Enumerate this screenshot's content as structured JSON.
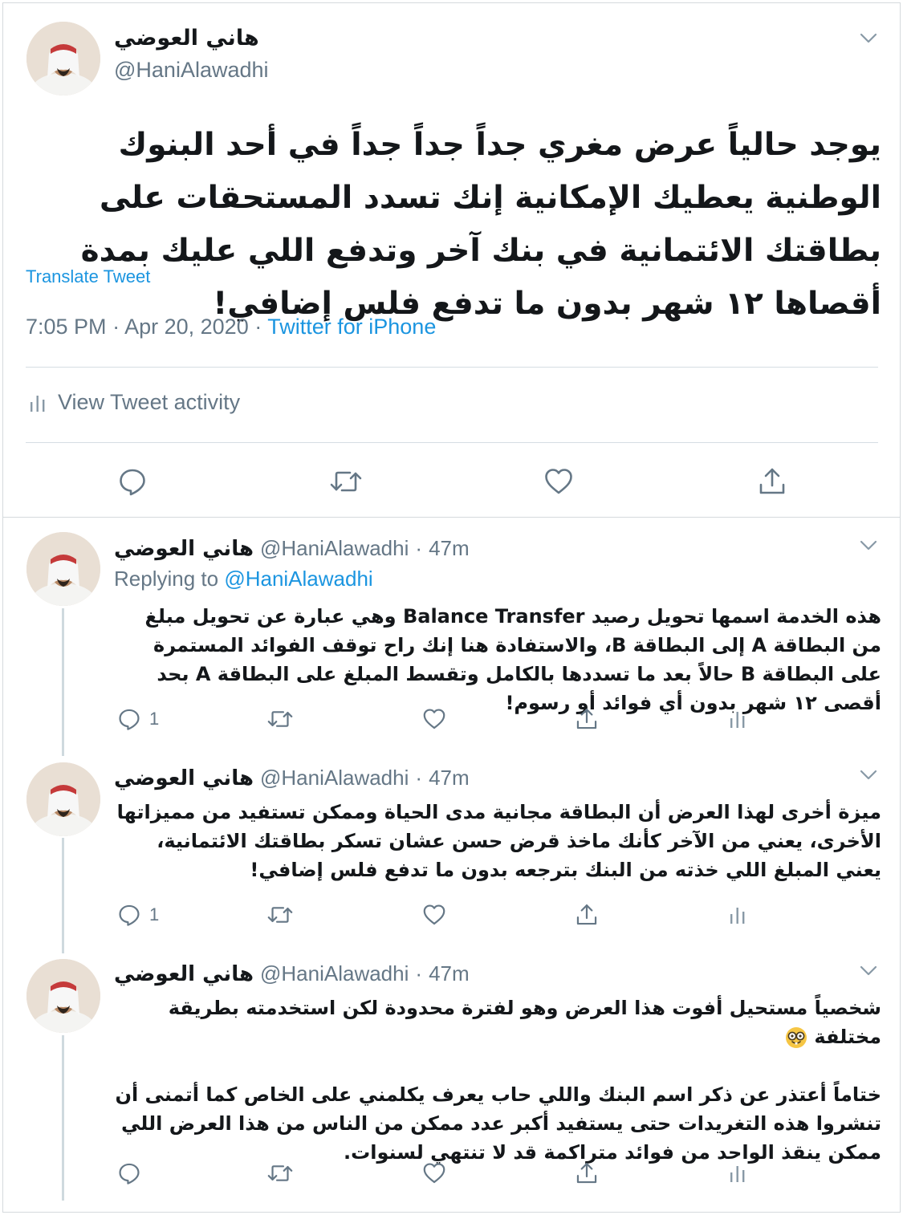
{
  "main_tweet": {
    "display_name": "هاني العوضي",
    "handle": "@HaniAlawadhi",
    "text": "يوجد حالياً عرض مغري جداً جداً جداً في أحد البنوك الوطنية يعطيك الإمكانية إنك تسدد المستحقات على بطاقتك الائتمانية في بنك آخر وتدفع اللي عليك بمدة أقصاها ١٢ شهر بدون ما تدفع فلس إضافي!",
    "translate_label": "Translate Tweet",
    "time": "7:05 PM",
    "date": "Apr 20, 2020",
    "separator": "·",
    "source": "Twitter for iPhone",
    "activity_label": "View Tweet activity",
    "actions": [
      "reply-icon",
      "retweet-icon",
      "like-icon",
      "share-icon"
    ]
  },
  "replies": [
    {
      "display_name": "هاني العوضي",
      "handle": "@HaniAlawadhi",
      "separator": "·",
      "time": "47m",
      "replying_label": "Replying to",
      "replying_to": "@HaniAlawadhi",
      "text": "هذه الخدمة اسمها تحويل رصيد Balance Transfer وهي عبارة عن تحويل مبلغ من البطاقة A إلى البطاقة B، والاستفادة هنا إنك راح توقف الفوائد المستمرة على البطاقة B حالاً بعد ما تسددها بالكامل وتقسط المبلغ على البطاقة A بحد أقصى ١٢ شهر بدون أي فوائد أو رسوم!",
      "reply_count": "1"
    },
    {
      "display_name": "هاني العوضي",
      "handle": "@HaniAlawadhi",
      "separator": "·",
      "time": "47m",
      "text": "ميزة أخرى لهذا العرض أن البطاقة مجانية مدى الحياة وممكن تستفيد من مميزاتها الأخرى، يعني من الآخر كأنك ماخذ قرض حسن عشان تسكر بطاقتك الائتمانية، يعني المبلغ اللي خذته من البنك بترجعه بدون ما تدفع فلس إضافي!",
      "reply_count": "1"
    },
    {
      "display_name": "هاني العوضي",
      "handle": "@HaniAlawadhi",
      "separator": "·",
      "time": "47m",
      "text_1": "شخصياً مستحيل أفوت هذا العرض وهو لفترة محدودة لكن استخدمته بطريقة مختلفة",
      "emoji": "nerd-face-emoji",
      "text_2": "ختاماً أعتذر عن ذكر اسم البنك واللي حاب يعرف يكلمني على الخاص كما أتمنى أن تنشروا هذه التغريدات حتى يستفيد أكبر عدد ممكن من الناس من هذا العرض اللي ممكن ينقذ الواحد من فوائد متراكمة قد لا تنتهي لسنوات.",
      "reply_count": ""
    }
  ],
  "colors": {
    "text": "#14171a",
    "muted": "#657786",
    "link": "#1b95e0",
    "divider": "#d5dde3",
    "thread_line": "#cfd9de"
  }
}
